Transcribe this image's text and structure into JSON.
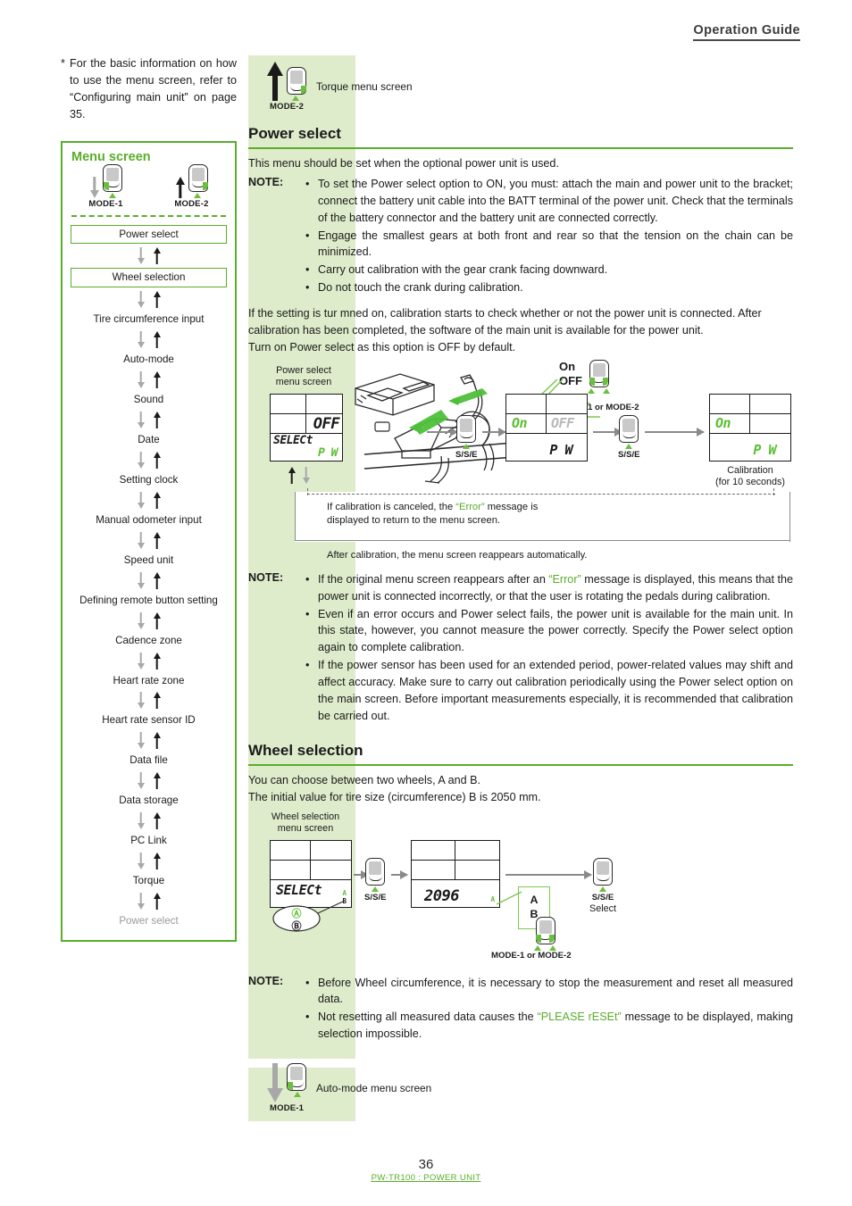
{
  "header": {
    "title": "Operation Guide"
  },
  "left": {
    "intro": {
      "star": "*",
      "text": "For the basic information on how to use the menu screen, refer to “Configuring main unit” on page 35."
    },
    "menu_box": {
      "title": "Menu screen",
      "mode1": "MODE-1",
      "mode2": "MODE-2",
      "items": [
        {
          "label": "Power select",
          "style": "boxed"
        },
        {
          "label": "Wheel selection",
          "style": "boxed"
        },
        {
          "label": "Tire circumference input",
          "style": "plain"
        },
        {
          "label": "Auto-mode",
          "style": "plain"
        },
        {
          "label": "Sound",
          "style": "plain"
        },
        {
          "label": "Date",
          "style": "plain"
        },
        {
          "label": "Setting clock",
          "style": "plain"
        },
        {
          "label": "Manual odometer input",
          "style": "plain"
        },
        {
          "label": "Speed unit",
          "style": "plain"
        },
        {
          "label": "Defining remote button setting",
          "style": "plain"
        },
        {
          "label": "Cadence zone",
          "style": "plain"
        },
        {
          "label": "Heart rate zone",
          "style": "plain"
        },
        {
          "label": "Heart rate sensor ID",
          "style": "plain"
        },
        {
          "label": "Data file",
          "style": "plain"
        },
        {
          "label": "Data storage",
          "style": "plain"
        },
        {
          "label": "PC Link",
          "style": "plain"
        },
        {
          "label": "Torque",
          "style": "plain"
        },
        {
          "label": "Power select",
          "style": "dim"
        }
      ]
    }
  },
  "right": {
    "top_flow": {
      "mode_label": "MODE-2",
      "screen_label": "Torque menu screen"
    },
    "power_select": {
      "heading": "Power select",
      "intro": "This menu should be set when the optional power unit is used.",
      "note_label": "NOTE:",
      "notes": [
        "To set the Power select option to ON, you must: attach the main and power unit to the bracket; connect the battery unit cable into the BATT terminal of the power unit. Check that the terminals of the battery connector and the battery unit are connected correctly.",
        "Engage the smallest gears at both front and rear so that the tension on the chain can be minimized.",
        "Carry out calibration with the gear crank facing downward.",
        "Do not touch the crank during calibration."
      ],
      "para_lines": [
        "If the setting is tur mned on, calibration starts to check whether or not the power unit is connected. After calibration has been completed, the software of the main unit is available for the power unit.",
        "Turn on Power select as this option is OFF by default."
      ],
      "diagram": {
        "screen1_caption_line1": "Power select",
        "screen1_caption_line2": "menu screen",
        "lcd1": {
          "top_right": "OFF",
          "mid_left": "SELECt",
          "bottom": "P W"
        },
        "lcd2": {
          "cell_on": "On",
          "cell_off": "OFF",
          "bottom": "P W"
        },
        "lcd3": {
          "cell_on": "On",
          "bottom": "P W"
        },
        "toggle_on": "On",
        "toggle_off": "OFF",
        "toggle_mode": "MODE-1 or MODE-2",
        "sse_1": "S/S/E",
        "sse_2": "S/S/E",
        "calibration_line1": "Calibration",
        "calibration_line2": "(for 10 seconds)",
        "error_note_line1": "If calibration is canceled, the “Error” message is",
        "error_note_line2": "displayed to return to the menu screen.",
        "error_word": "“Error”",
        "after_note": "After calibration, the menu screen reappears automatically."
      },
      "note_label2": "NOTE:",
      "notes2": [
        "If the original menu screen reappears after an “Error” message is displayed, this means that the power unit is connected incorrectly, or that the user is rotating the pedals during calibration.",
        "Even if an error occurs and Power select fails, the power unit is available for the main unit. In this state, however, you cannot measure the power correctly. Specify the Power select option again to complete calibration.",
        "If the power sensor has been used for an extended period, power-related values may shift and affect accuracy. Make sure to carry out calibration periodically using the Power select option on the main screen. Before important measurements especially, it is recommended that calibration be carried out."
      ]
    },
    "wheel_selection": {
      "heading": "Wheel selection",
      "line1": "You can choose between two wheels, A and B.",
      "line2": "The initial value for tire size (circumference) B is 2050 mm.",
      "diagram": {
        "caption_line1": "Wheel selection",
        "caption_line2": "menu screen",
        "lcd1_bottom": "SELECt",
        "lcd1_marker_a": "A",
        "lcd1_marker_b": "B",
        "lcd2_value": "2096",
        "lcd2_marker": "A",
        "callout_a": "A",
        "callout_b": "B",
        "sse_1": "S/S/E",
        "sse_2": "S/S/E",
        "sse_2_sub": "Select",
        "mode_label": "MODE-1 or MODE-2"
      },
      "note_label": "NOTE:",
      "notes": [
        "Before Wheel circumference, it is necessary to stop the measurement and reset all measured data.",
        "Not resetting all measured data causes the “PLEASE rESEt” message to be displayed, making selection impossible."
      ],
      "error_phrase": "“PLEASE rESEt”"
    },
    "bottom_flow": {
      "mode_label": "MODE-1",
      "screen_label": "Auto-mode menu screen"
    }
  },
  "footer": {
    "page": "36",
    "product": "PW-TR100 : POWER UNIT"
  },
  "colors": {
    "green": "#5aad2b",
    "light_green_band": "#dfeccb",
    "lcd_green": "#5cbf32",
    "gray_arrow": "#a8a8a8"
  }
}
